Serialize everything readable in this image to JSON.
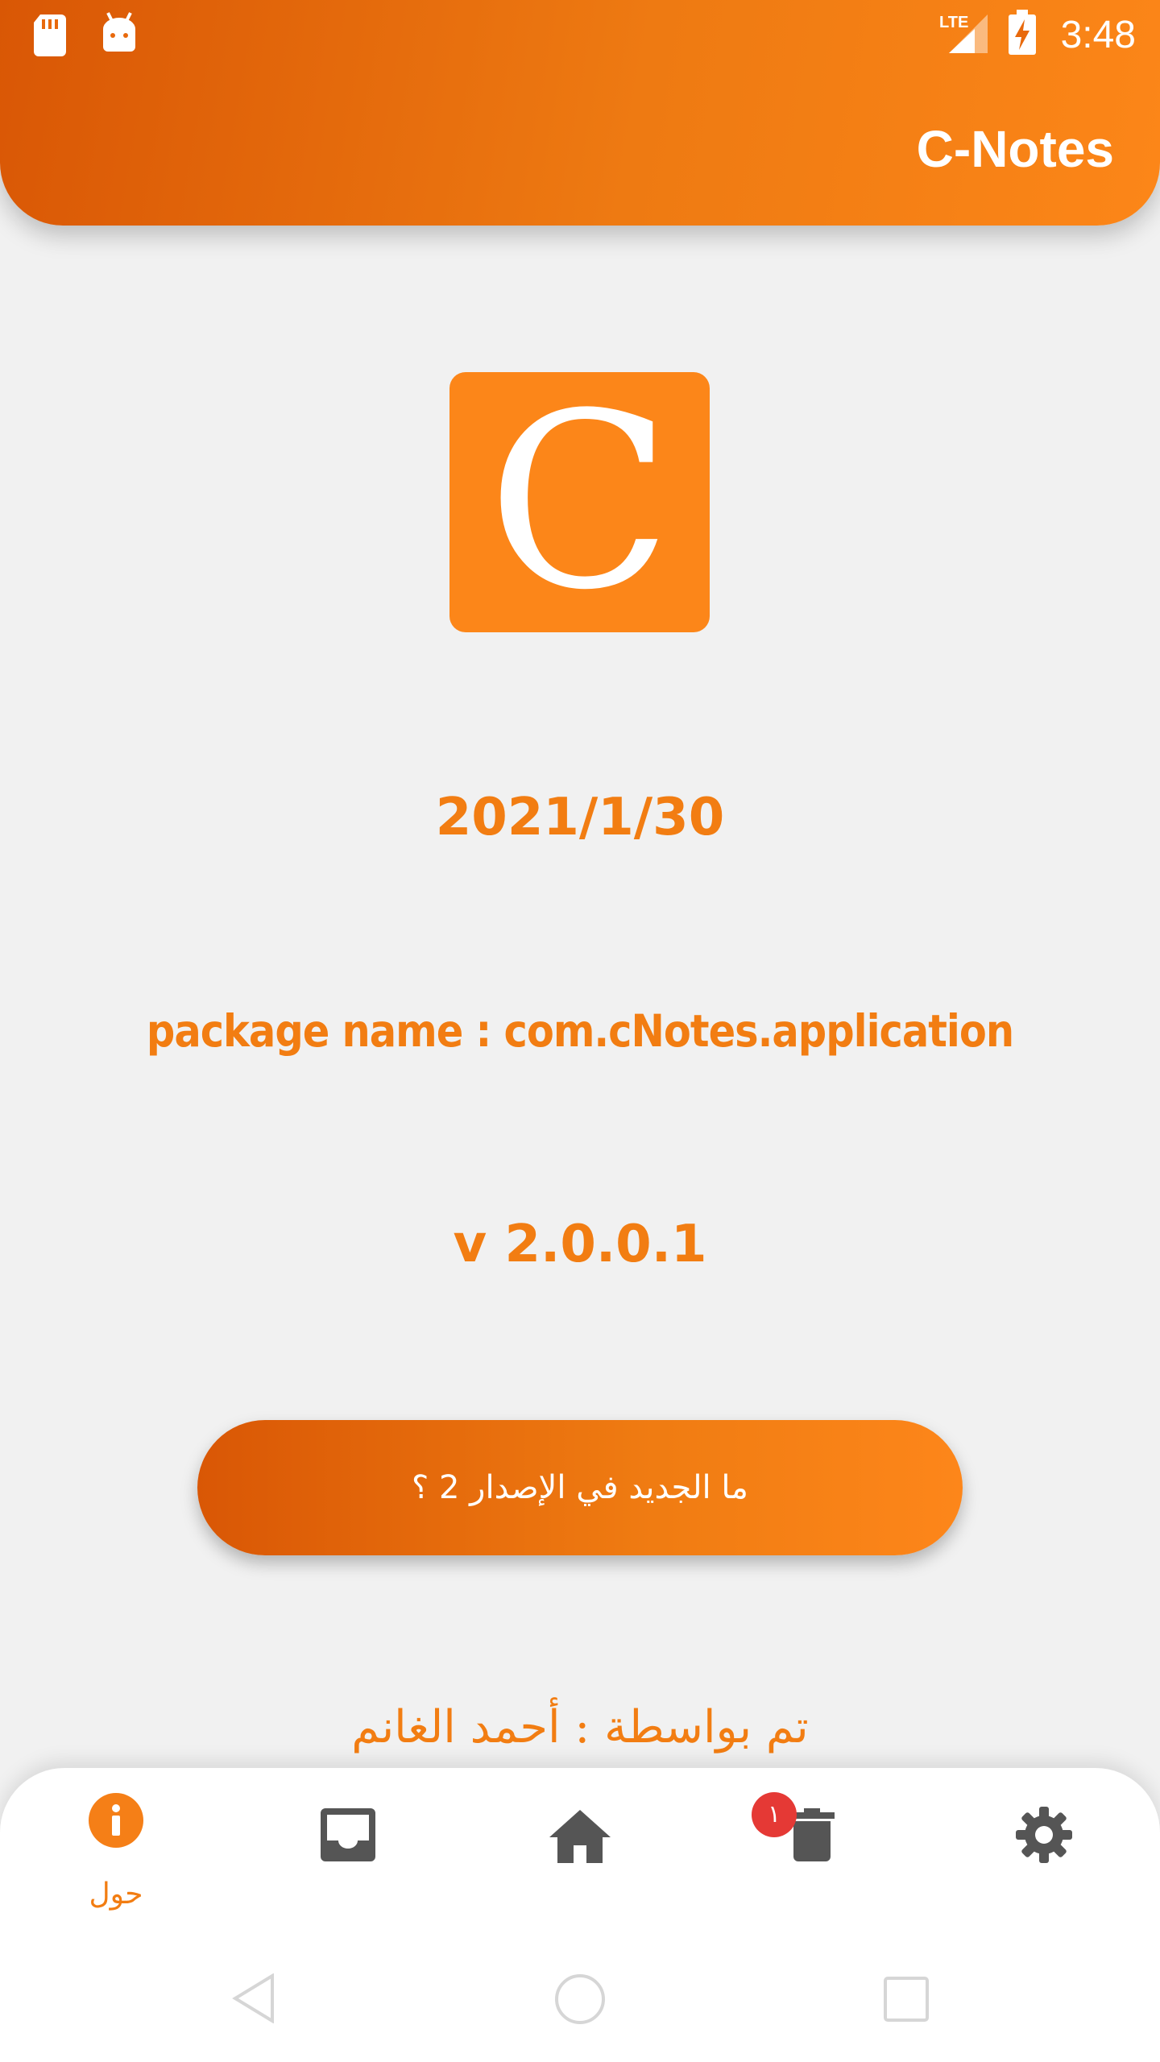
{
  "status_bar": {
    "time": "3:48",
    "network": "LTE",
    "icons": [
      "sd-card-icon",
      "android-debug-icon",
      "lte-signal-icon",
      "battery-charging-icon"
    ]
  },
  "header": {
    "title": "C-Notes"
  },
  "logo": {
    "letter": "C",
    "color": "#fc8619"
  },
  "about": {
    "release_date": "2021/1/30",
    "package_name": "package name : com.cNotes.application",
    "version": "v 2.0.0.1",
    "whats_new_button": "ما الجديد في الإصدار 2 ؟",
    "author": "تم بواسطة : أحمد الغانم"
  },
  "bottom_nav": {
    "items": [
      {
        "icon": "info-icon",
        "label": "حول",
        "active": true
      },
      {
        "icon": "inbox-icon"
      },
      {
        "icon": "home-icon"
      },
      {
        "icon": "trash-icon",
        "badge": "١"
      },
      {
        "icon": "gear-icon"
      }
    ]
  },
  "colors": {
    "accent": "#f27d12",
    "gradient_start": "#d95705",
    "gradient_end": "#fc8618",
    "nav_icon": "#555555",
    "badge": "#e53935"
  }
}
